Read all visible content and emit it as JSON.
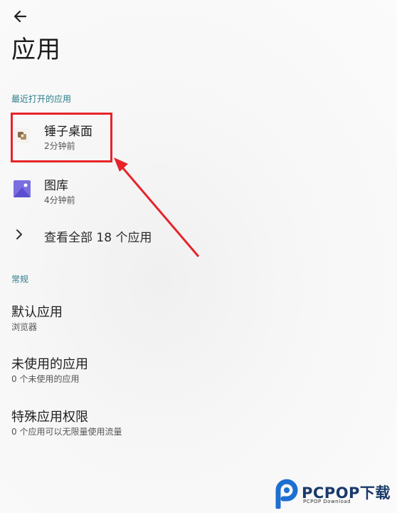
{
  "header": {
    "title": "应用"
  },
  "recent": {
    "label": "最近打开的应用",
    "apps": [
      {
        "name": "锤子桌面",
        "time": "2分钟前",
        "icon": "smartisan-launcher-icon"
      },
      {
        "name": "图库",
        "time": "4分钟前",
        "icon": "gallery-icon"
      }
    ],
    "see_all": "查看全部 18 个应用"
  },
  "general": {
    "label": "常规",
    "items": [
      {
        "name": "默认应用",
        "sub": "浏览器"
      },
      {
        "name": "未使用的应用",
        "sub": "0 个未使用的应用"
      },
      {
        "name": "特殊应用权限",
        "sub": "0 个应用可以无限量使用流量"
      }
    ]
  },
  "annotation": {
    "color": "#e6242a"
  },
  "watermark": {
    "brand": "PCPOP下载",
    "sub": "PCPOP Download"
  }
}
